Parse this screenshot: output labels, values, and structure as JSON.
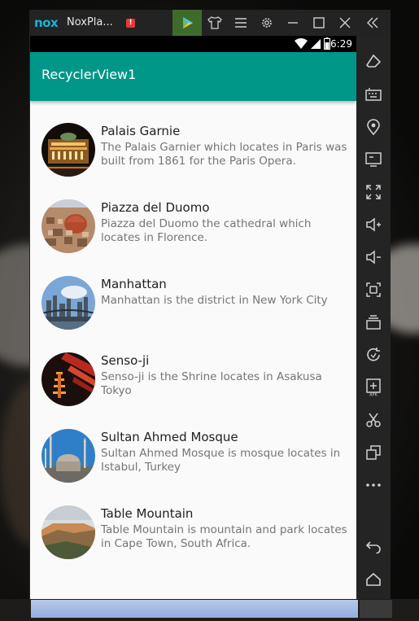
{
  "emulator": {
    "app_name": "NoxPla...",
    "alert_badge": "!",
    "title_icons": [
      "play-store-icon",
      "shirt-icon",
      "menu-icon",
      "gear-icon",
      "minimize-icon",
      "maximize-icon",
      "close-icon",
      "collapse-sidebar-icon"
    ],
    "side_toolbar": [
      "eraser-icon",
      "keyboard-icon",
      "location-icon",
      "screen-icon",
      "fullscreen-icon",
      "volume-up-icon",
      "volume-down-icon",
      "screenshot-icon",
      "stack-icon",
      "rotate-icon",
      "apk-icon",
      "scissors-icon",
      "multi-window-icon",
      "more-icon",
      "back-icon",
      "home-icon"
    ],
    "accent_color": "#18b4d9"
  },
  "status_bar": {
    "time": "6:29"
  },
  "app_bar": {
    "title": "RecyclerView1",
    "color": "#009688"
  },
  "items": [
    {
      "title": "Palais Garnie",
      "description": "The Palais Garnier which locates in Paris was built from 1861 for the Paris Opera."
    },
    {
      "title": "Piazza del Duomo",
      "description": "Piazza del Duomo the cathedral which locates in Florence."
    },
    {
      "title": "Manhattan",
      "description": "Manhattan is the district in New York City"
    },
    {
      "title": "Senso-ji",
      "description": "Senso-ji is the Shrine locates in Asakusa Tokyo"
    },
    {
      "title": "Sultan Ahmed Mosque",
      "description": "Sultan Ahmed Mosque is mosque locates in Istabul, Turkey"
    },
    {
      "title": "Table Mountain",
      "description": "Table Mountain is mountain and park locates in Cape Town, South Africa."
    }
  ]
}
